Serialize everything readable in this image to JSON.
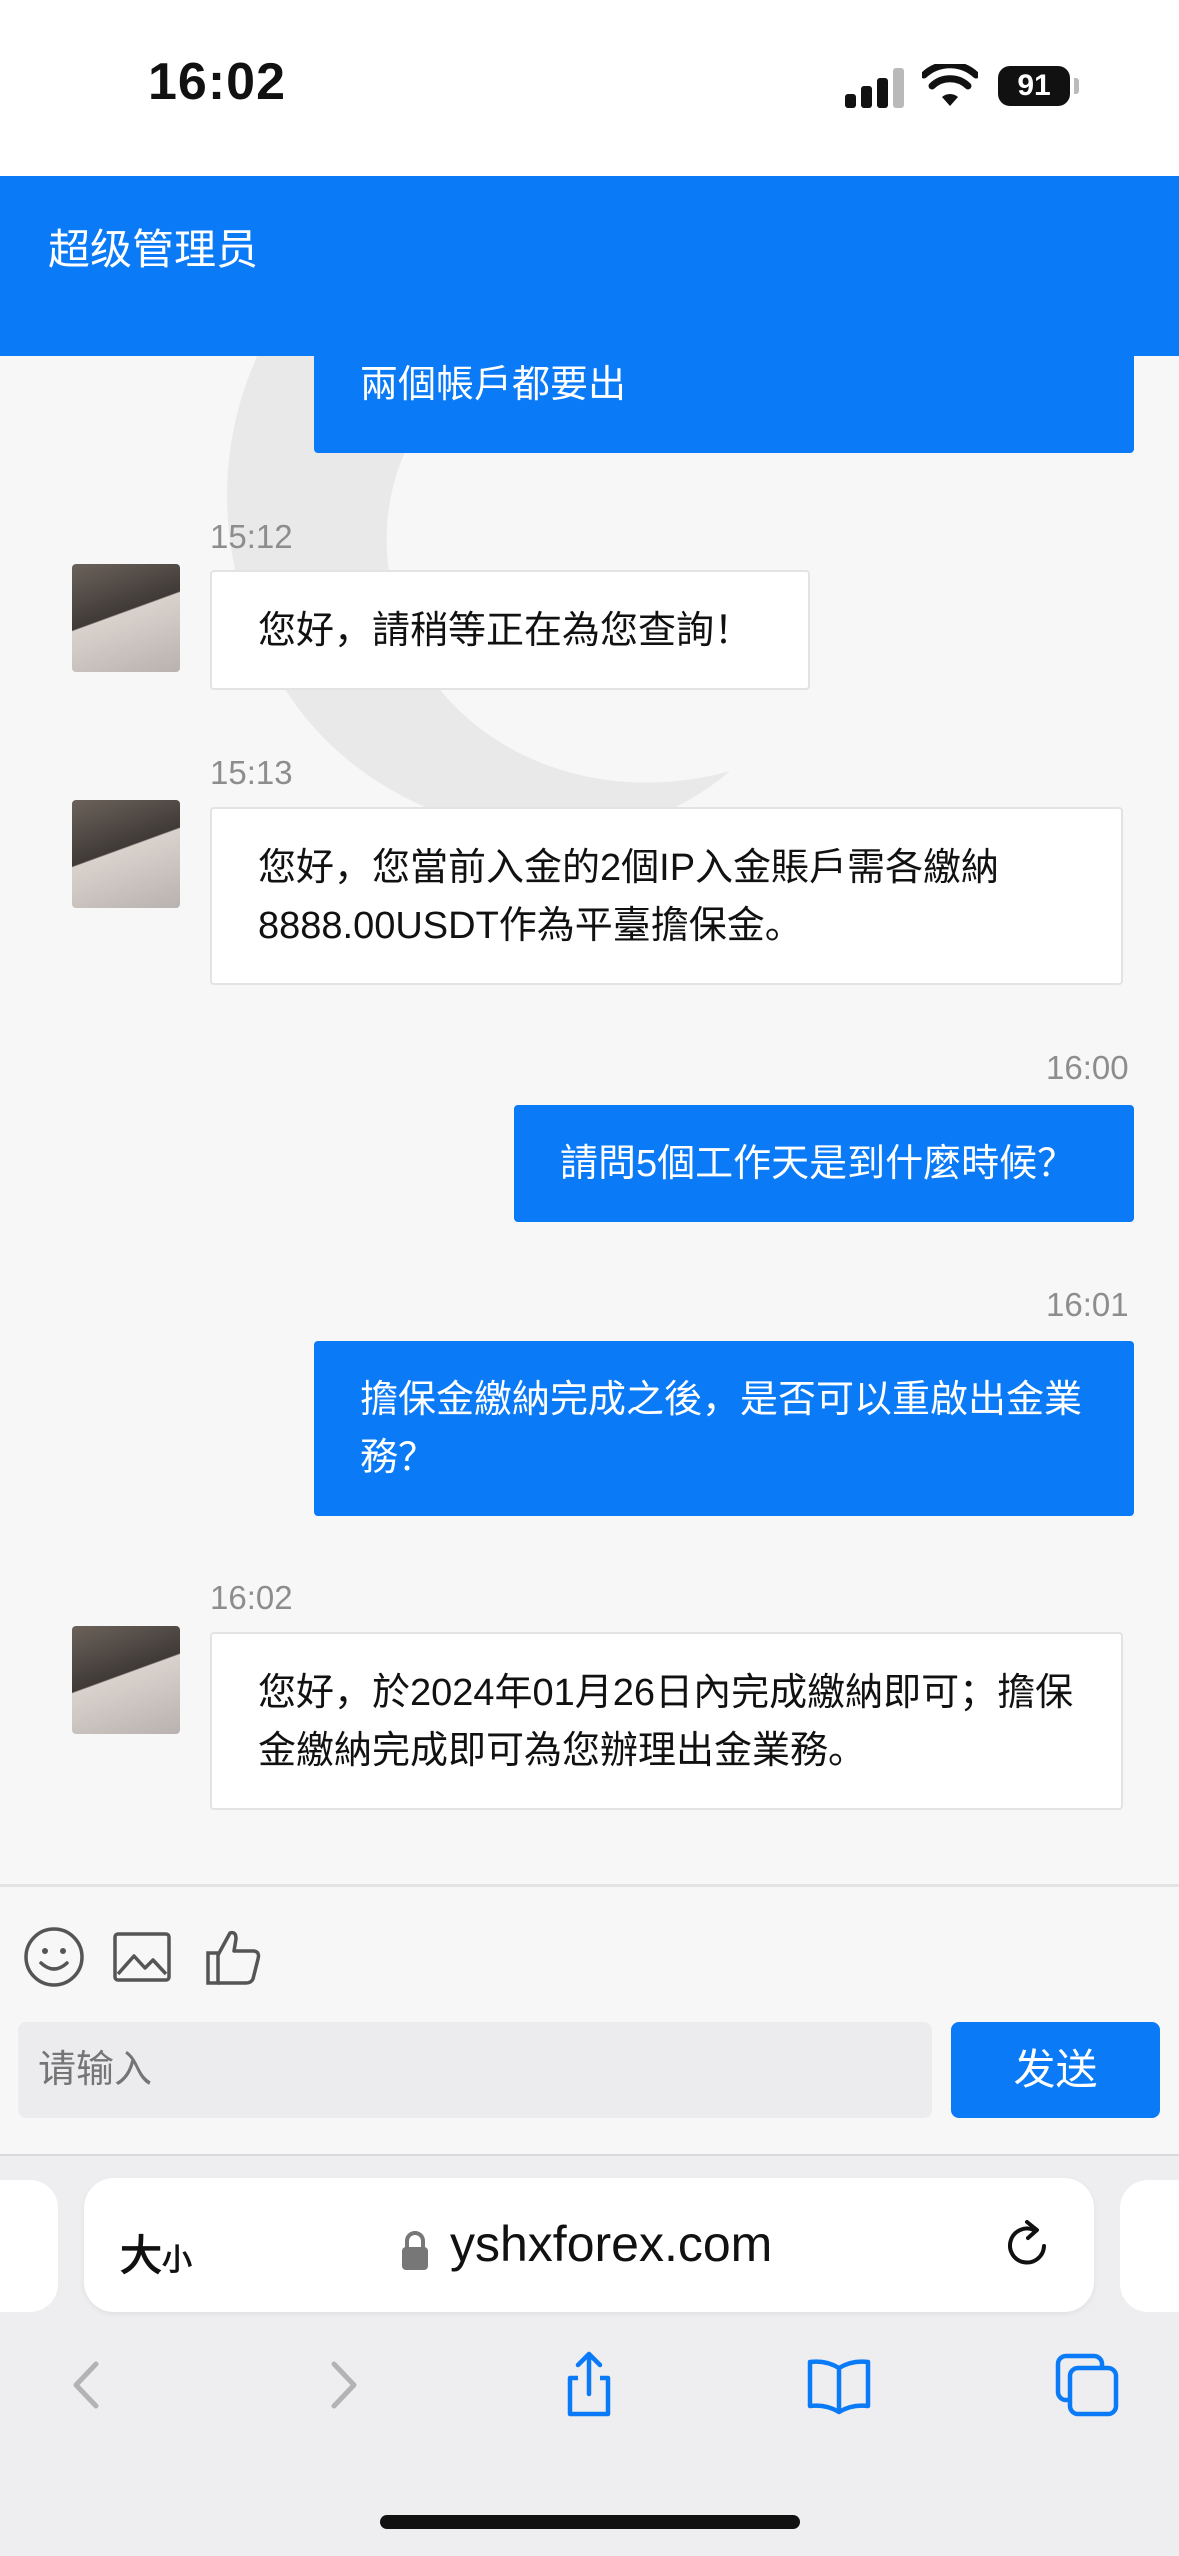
{
  "status_bar": {
    "time": "16:02",
    "battery": "91"
  },
  "header": {
    "title": "超级管理员"
  },
  "messages": [
    {
      "side": "out",
      "time": "",
      "text": "兩個帳戶都要出"
    },
    {
      "side": "in",
      "time": "15:12",
      "text": "您好，請稍等正在為您查詢！"
    },
    {
      "side": "in",
      "time": "15:13",
      "text": "您好，您當前入金的2個IP入金賬戶需各繳納8888.00USDT作為平臺擔保金。"
    },
    {
      "side": "out",
      "time": "16:00",
      "text": "請問5個工作天是到什麼時候？"
    },
    {
      "side": "out",
      "time": "16:01",
      "text": "擔保金繳納完成之後，是否可以重啟出金業務？"
    },
    {
      "side": "in",
      "time": "16:02",
      "text": "您好，於2024年01月26日內完成繳納即可；擔保金繳納完成即可為您辦理出金業務。"
    }
  ],
  "composer": {
    "placeholder": "请输入",
    "send_label": "发送"
  },
  "browser": {
    "text_size_label": "大",
    "text_size_small": "小",
    "url": "yshxforex.com"
  },
  "colors": {
    "accent": "#0a7af7",
    "background": "#f7f7f8"
  },
  "icons": [
    "emoji-icon",
    "image-icon",
    "thumbs-up-icon",
    "lock-icon",
    "reload-icon",
    "back-icon",
    "forward-icon",
    "share-icon",
    "bookmarks-icon",
    "tabs-icon"
  ]
}
